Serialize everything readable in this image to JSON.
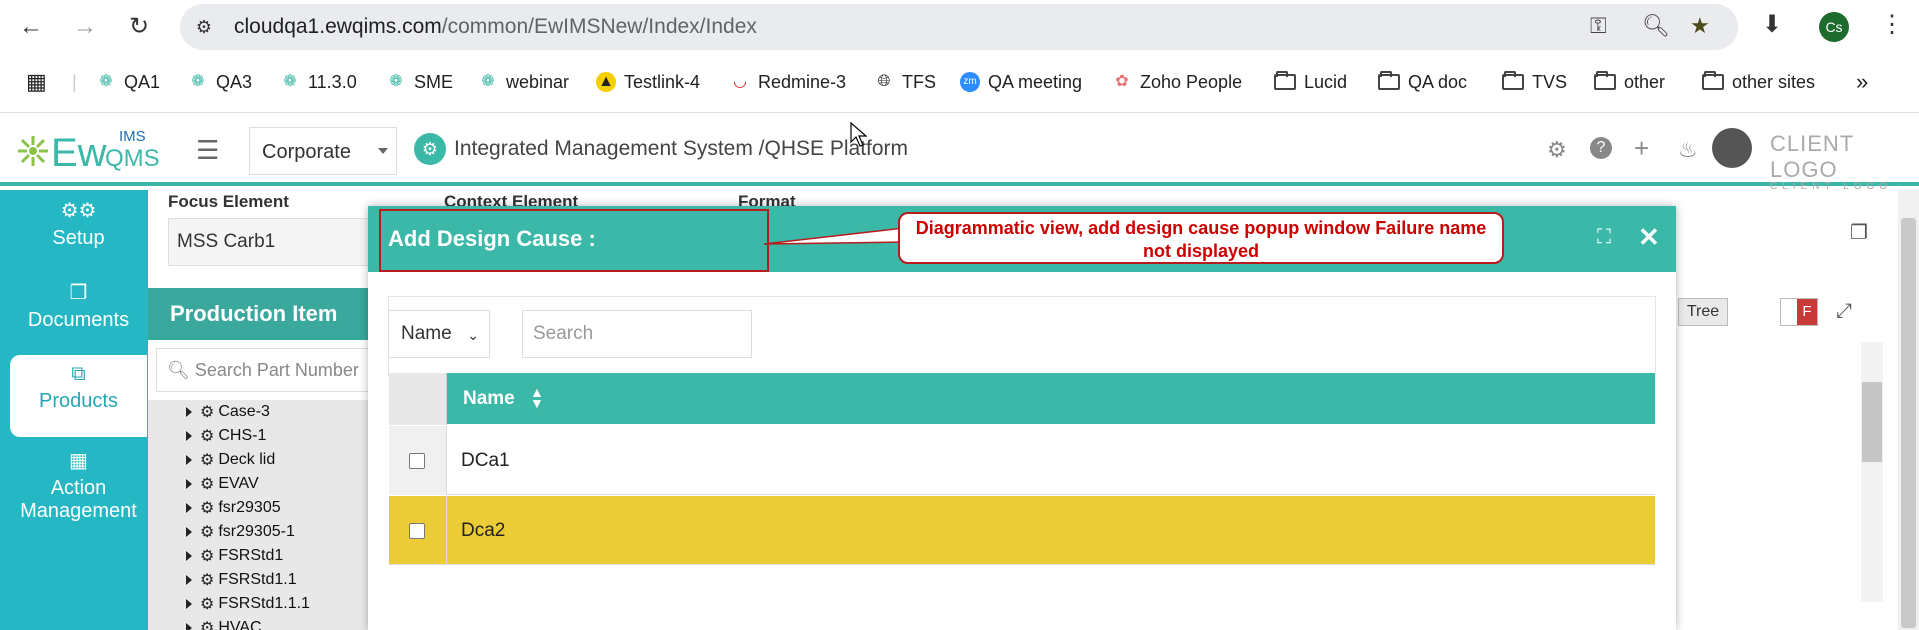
{
  "browser": {
    "url_host": "cloudqa1.ewqims.com",
    "url_path": "/common/EwIMSNew/Index/Index",
    "profile_initials": "Cs",
    "bookmarks": [
      "QA1",
      "QA3",
      "11.3.0",
      "SME",
      "webinar",
      "Testlink-4",
      "Redmine-3",
      "TFS",
      "QA meeting",
      "Zoho People",
      "Lucid",
      "QA doc",
      "TVS",
      "other",
      "other sites"
    ],
    "zm_badge": "zm"
  },
  "header": {
    "logo_text_ew": "Ew",
    "logo_text_ims": "IMS",
    "logo_text_qms": "QMS",
    "org_select": "Corporate",
    "title": "Integrated Management System /QHSE Platform",
    "client_logo": "CLIENT LOGO",
    "client_logo_sub": "CLIENT LOGO"
  },
  "sidebar": {
    "items": [
      {
        "label": "Setup",
        "icon": "gears-icon"
      },
      {
        "label": "Documents",
        "icon": "copy-icon"
      },
      {
        "label": "Products",
        "icon": "products-icon"
      },
      {
        "label": "Action Management",
        "icon": "building-icon"
      }
    ]
  },
  "page": {
    "focus_label": "Focus Element",
    "focus_value": "MSS Carb1",
    "context_label": "Context Element",
    "format_label": "Format",
    "production_header": "Production Item",
    "part_search_placeholder": "Search Part Number",
    "tree_items": [
      "Case-3",
      "CHS-1",
      "Deck lid",
      "EVAV",
      "fsr29305",
      "fsr29305-1",
      "FSRStd1",
      "FSRStd1.1",
      "FSRStd1.1.1",
      "HVAC"
    ],
    "tree_toggle": "Tree",
    "f_toggle": "F"
  },
  "modal": {
    "title": "Add Design Cause :",
    "filter_field": "Name",
    "search_placeholder": "Search",
    "column_name": "Name",
    "rows": [
      {
        "name": "DCa1",
        "highlighted": false
      },
      {
        "name": "Dca2",
        "highlighted": true
      }
    ],
    "highlight_color": "#ebcb36"
  },
  "annotation": {
    "text": "Diagrammatic view, add design cause popup window Failure name not displayed"
  },
  "colors": {
    "teal": "#3bb8a8",
    "sidebar": "#25b7c4",
    "annotation_red": "#b71c1c"
  }
}
